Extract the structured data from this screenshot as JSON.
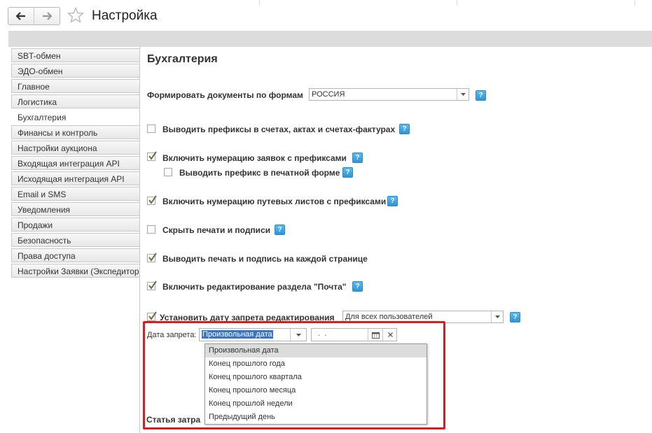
{
  "window": {
    "title": "Настройка"
  },
  "sidebar": {
    "items": [
      {
        "label": "SBT-обмен"
      },
      {
        "label": "ЭДО-обмен"
      },
      {
        "label": "Главное"
      },
      {
        "label": "Логистика"
      },
      {
        "label": "Бухгалтерия",
        "active": true
      },
      {
        "label": "Финансы и контроль"
      },
      {
        "label": "Настройки аукциона"
      },
      {
        "label": "Входящая интеграция API"
      },
      {
        "label": "Исходящая интеграция API"
      },
      {
        "label": "Email и SMS"
      },
      {
        "label": "Уведомления"
      },
      {
        "label": "Продажи"
      },
      {
        "label": "Безопасность"
      },
      {
        "label": "Права доступа"
      },
      {
        "label": "Настройки Заявки (Экспедитора)"
      }
    ]
  },
  "main": {
    "heading": "Бухгалтерия",
    "forms": {
      "label": "Формировать документы по формам",
      "value": "РОССИЯ"
    },
    "options": {
      "prefixes_invoices": {
        "label": "Выводить префиксы в счетах, актах и счетах-фактурах",
        "checked": false
      },
      "order_numbering": {
        "label": "Включить нумерацию заявок с префиксами",
        "checked": true
      },
      "print_prefix": {
        "label": "Выводить префикс в печатной форме",
        "checked": false
      },
      "waybill_numbering": {
        "label": "Включить нумерацию путевых листов с префиксами",
        "checked": true
      },
      "hide_stamps": {
        "label": "Скрыть печати и подписи",
        "checked": false
      },
      "stamp_each_page": {
        "label": "Выводить печать и подпись на каждой странице",
        "checked": true
      },
      "mail_editing": {
        "label": "Включить редактирование раздела \"Почта\"",
        "checked": true
      },
      "edit_lock": {
        "label": "Установить дату запрета редактирования",
        "checked": true,
        "users_value": "Для всех пользователей"
      }
    },
    "lock_date": {
      "label": "Дата запрета:",
      "mode_value": "Произвольная дата",
      "date_value": " .  .",
      "dropdown_options": [
        "Произвольная дата",
        "Конец прошлого года",
        "Конец прошлого квартала",
        "Конец прошлого месяца",
        "Конец прошлой недели",
        "Предыдущий день"
      ],
      "selected_option": "Произвольная дата"
    },
    "partial_label": "Статья затра",
    "help_glyph": "?"
  },
  "colors": {
    "highlight": "#d81e1e",
    "help": "#2f95d9",
    "check": "#7a6a3f"
  }
}
